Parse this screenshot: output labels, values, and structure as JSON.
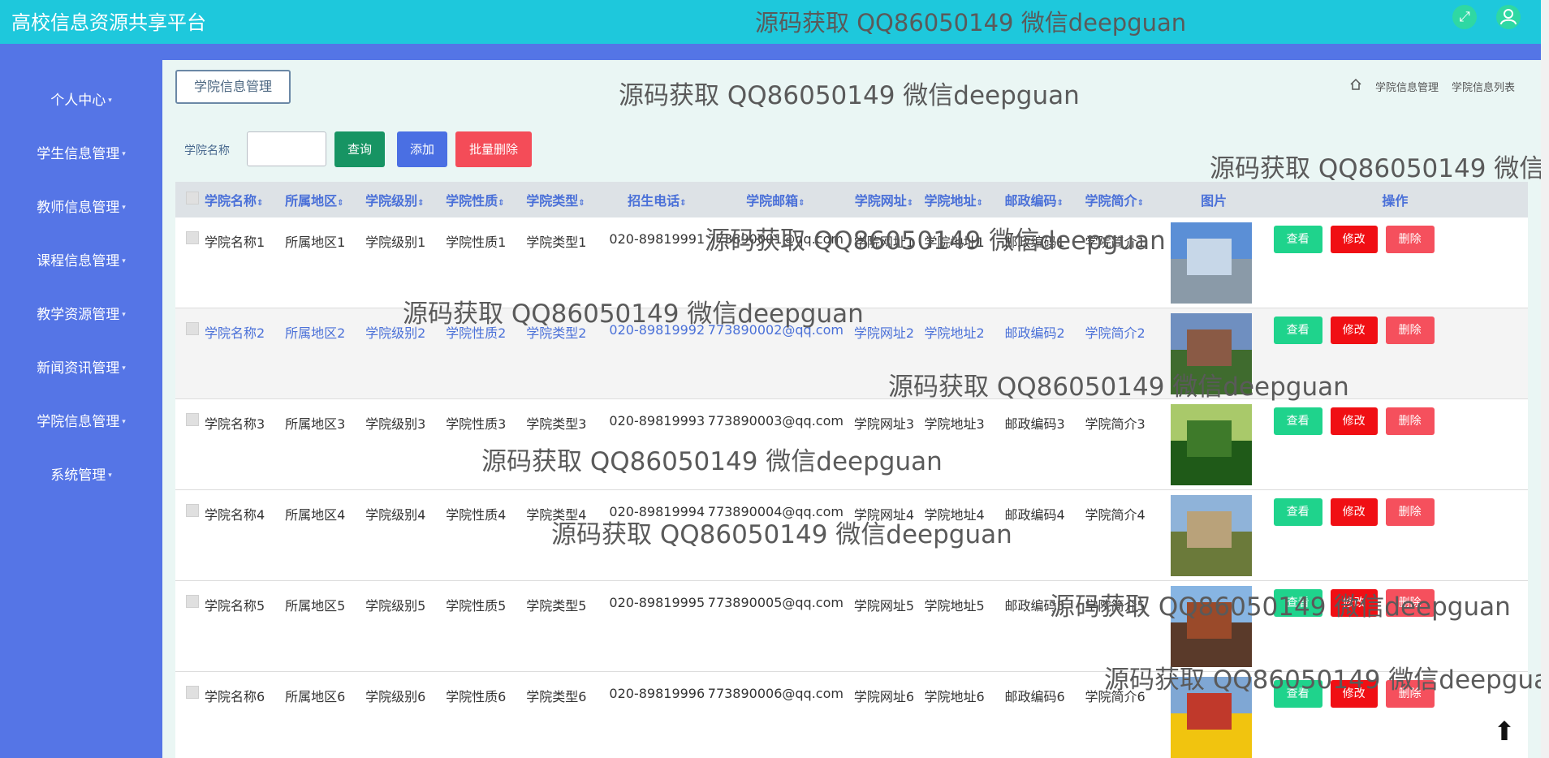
{
  "app_title": "高校信息资源共享平台",
  "watermark": "源码获取 QQ86050149 微信deepguan",
  "top_icons": {
    "fullscreen": "expand-arrows-icon",
    "user": "user-icon"
  },
  "sidebar": {
    "items": [
      {
        "label": "个人中心"
      },
      {
        "label": "学生信息管理"
      },
      {
        "label": "教师信息管理"
      },
      {
        "label": "课程信息管理"
      },
      {
        "label": "教学资源管理"
      },
      {
        "label": "新闻资讯管理"
      },
      {
        "label": "学院信息管理"
      },
      {
        "label": "系统管理"
      }
    ]
  },
  "page_tag": "学院信息管理",
  "breadcrumb": {
    "home_icon": "home-icon",
    "level1": "学院信息管理",
    "level2": "学院信息列表"
  },
  "search": {
    "label": "学院名称",
    "value": "",
    "query_label": "查询",
    "add_label": "添加",
    "batch_delete_label": "批量删除"
  },
  "colors": {
    "accent": "#1ec8dc",
    "sidebar": "#5575e6",
    "view": "#1fd38c",
    "edit": "#f00f14",
    "delete": "#f5505d",
    "query": "#179463",
    "add": "#4a6fe3",
    "batch_delete": "#f44c58"
  },
  "table": {
    "headers": [
      "学院名称",
      "所属地区",
      "学院级别",
      "学院性质",
      "学院类型",
      "招生电话",
      "学院邮箱",
      "学院网址",
      "学院地址",
      "邮政编码",
      "学院简介",
      "图片",
      "操作"
    ],
    "rows": [
      {
        "name": "学院名称1",
        "region": "所属地区1",
        "level": "学院级别1",
        "nature": "学院性质1",
        "type": "学院类型1",
        "phone": "020-89819991",
        "email": "773890001@qq.com",
        "website": "学院网址1",
        "address": "学院地址1",
        "postcode": "邮政编码1",
        "intro": "学院简介1"
      },
      {
        "name": "学院名称2",
        "region": "所属地区2",
        "level": "学院级别2",
        "nature": "学院性质2",
        "type": "学院类型2",
        "phone": "020-89819992",
        "email": "773890002@qq.com",
        "website": "学院网址2",
        "address": "学院地址2",
        "postcode": "邮政编码2",
        "intro": "学院简介2"
      },
      {
        "name": "学院名称3",
        "region": "所属地区3",
        "level": "学院级别3",
        "nature": "学院性质3",
        "type": "学院类型3",
        "phone": "020-89819993",
        "email": "773890003@qq.com",
        "website": "学院网址3",
        "address": "学院地址3",
        "postcode": "邮政编码3",
        "intro": "学院简介3"
      },
      {
        "name": "学院名称4",
        "region": "所属地区4",
        "level": "学院级别4",
        "nature": "学院性质4",
        "type": "学院类型4",
        "phone": "020-89819994",
        "email": "773890004@qq.com",
        "website": "学院网址4",
        "address": "学院地址4",
        "postcode": "邮政编码4",
        "intro": "学院简介4"
      },
      {
        "name": "学院名称5",
        "region": "所属地区5",
        "level": "学院级别5",
        "nature": "学院性质5",
        "type": "学院类型5",
        "phone": "020-89819995",
        "email": "773890005@qq.com",
        "website": "学院网址5",
        "address": "学院地址5",
        "postcode": "邮政编码5",
        "intro": "学院简介5"
      },
      {
        "name": "学院名称6",
        "region": "所属地区6",
        "level": "学院级别6",
        "nature": "学院性质6",
        "type": "学院类型6",
        "phone": "020-89819996",
        "email": "773890006@qq.com",
        "website": "学院网址6",
        "address": "学院地址6",
        "postcode": "邮政编码6",
        "intro": "学院简介6"
      }
    ],
    "actions": {
      "view": "查看",
      "edit": "修改",
      "delete": "删除"
    }
  },
  "back_to_top_icon": "arrow-up-icon"
}
